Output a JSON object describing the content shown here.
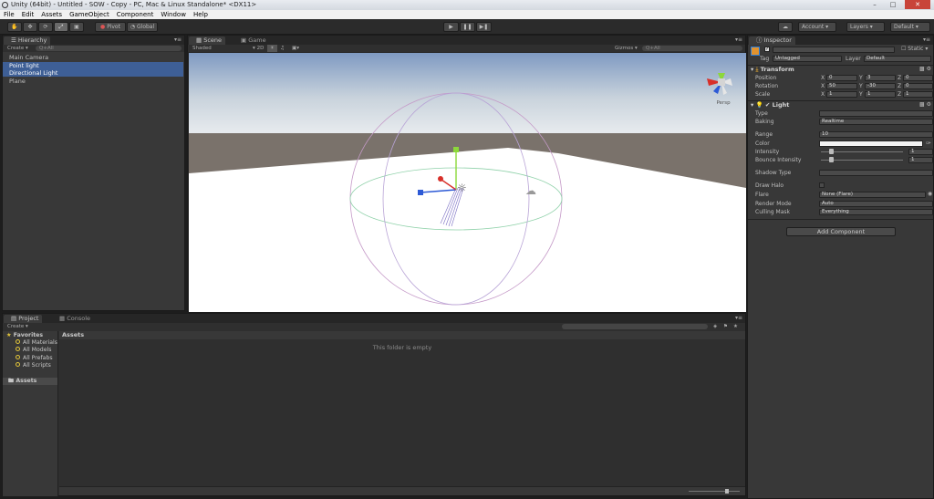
{
  "window": {
    "title": "Unity (64bit) - Untitled - SOW - Copy - PC, Mac & Linux Standalone* <DX11>"
  },
  "menubar": {
    "items": [
      "File",
      "Edit",
      "Assets",
      "GameObject",
      "Component",
      "Window",
      "Help"
    ]
  },
  "toolbar": {
    "pivot_label": "Pivot",
    "global_label": "Global",
    "account_label": "Account",
    "layers_label": "Layers",
    "layout_label": "Default"
  },
  "hierarchy": {
    "tab": "Hierarchy",
    "create_label": "Create",
    "search_placeholder": "Q+All",
    "items": [
      "Main Camera",
      "Point light",
      "Directional Light",
      "Plane"
    ]
  },
  "scene": {
    "tabs": [
      "Scene",
      "Game"
    ],
    "shading_mode": "Shaded",
    "mode_2d": "2D",
    "gizmos_label": "Gizmos",
    "search_placeholder": "Q+All",
    "persp_label": "Persp"
  },
  "inspector": {
    "tab": "Inspector",
    "static_label": "Static",
    "tag_label": "Tag",
    "tag_value": "Untagged",
    "layer_label": "Layer",
    "layer_value": "Default",
    "transform": {
      "title": "Transform",
      "rows": [
        {
          "label": "Position",
          "x": "0",
          "y": "3",
          "z": "0"
        },
        {
          "label": "Rotation",
          "x": "50",
          "y": "-30",
          "z": "0"
        },
        {
          "label": "Scale",
          "x": "1",
          "y": "1",
          "z": "1"
        }
      ]
    },
    "light": {
      "title": "Light",
      "type_label": "Type",
      "type_value": "",
      "baking_label": "Baking",
      "baking_value": "Realtime",
      "range_label": "Range",
      "range_value": "10",
      "color_label": "Color",
      "intensity_label": "Intensity",
      "intensity_value": "1",
      "intensity_level": 0.125,
      "bounce_label": "Bounce Intensity",
      "bounce_value": "1",
      "bounce_level": 0.125,
      "shadow_label": "Shadow Type",
      "shadow_value": "",
      "halo_label": "Draw Halo",
      "flare_label": "Flare",
      "flare_value": "None (Flare)",
      "render_mode_label": "Render Mode",
      "render_mode_value": "Auto",
      "culling_label": "Culling Mask",
      "culling_value": "Everything"
    },
    "add_component_label": "Add Component"
  },
  "project": {
    "tabs": [
      "Project",
      "Console"
    ],
    "create_label": "Create",
    "favorites_label": "Favorites",
    "favorites": [
      "All Materials",
      "All Models",
      "All Prefabs",
      "All Scripts"
    ],
    "assets_folder": "Assets",
    "breadcrumb": "Assets",
    "empty_message": "This folder is empty"
  },
  "colors": {
    "selection": "#3e5f96",
    "panel": "#383838",
    "sky_top": "#7f9ac2",
    "ground": "#ffffff",
    "axis_x": "#d8302a",
    "axis_y": "#8cd83a",
    "axis_z": "#2d5ad6"
  }
}
